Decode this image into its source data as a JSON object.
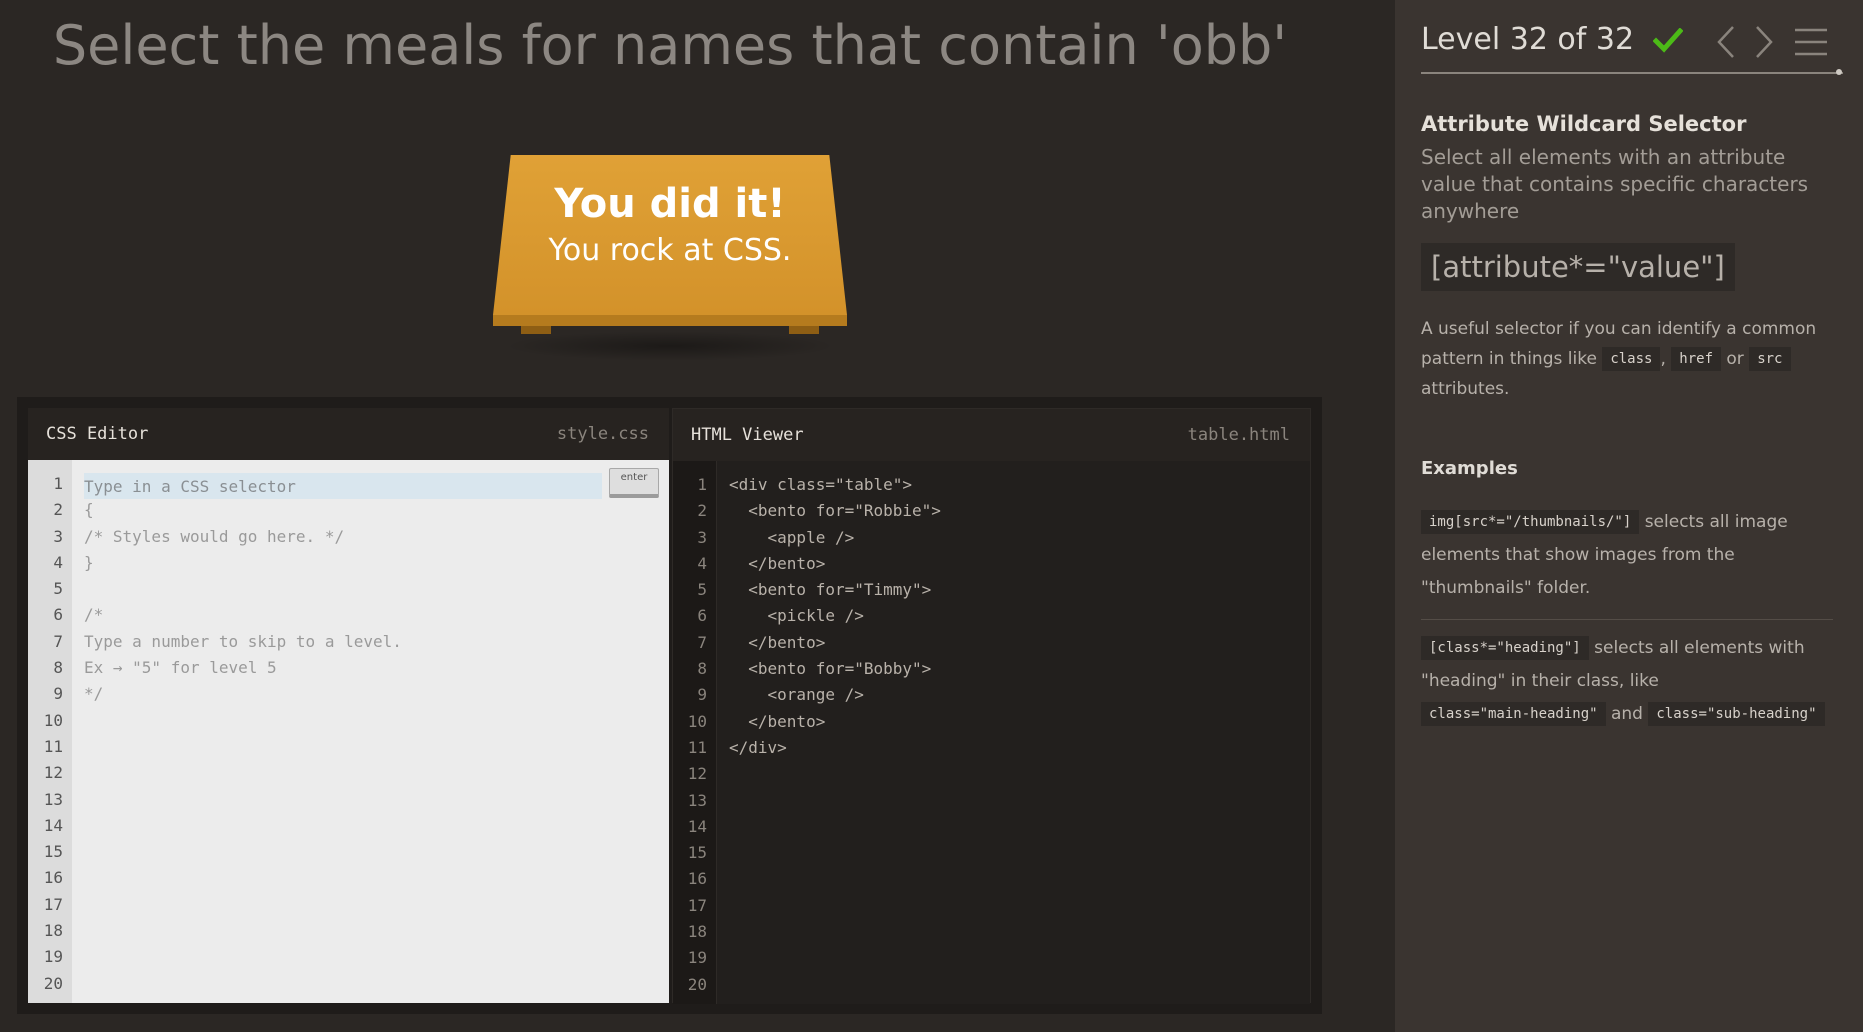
{
  "game": {
    "order": "Select the meals for names that contain 'obb'",
    "win_line1": "You did it!",
    "win_line2": "You rock at CSS."
  },
  "css_editor": {
    "title": "CSS Editor",
    "file": "style.css",
    "input_placeholder": "Type in a CSS selector",
    "enter_label": "enter",
    "line_numbers": [
      "1",
      "2",
      "3",
      "4",
      "5",
      "6",
      "7",
      "8",
      "9",
      "10",
      "11",
      "12",
      "13",
      "14",
      "15",
      "16",
      "17",
      "18",
      "19",
      "20"
    ],
    "lines": [
      "",
      "{",
      "/* Styles would go here. */",
      "}",
      "",
      "/*",
      "Type a number to skip to a level.",
      "Ex → \"5\" for level 5",
      "*/"
    ]
  },
  "html_viewer": {
    "title": "HTML Viewer",
    "file": "table.html",
    "line_numbers": [
      "1",
      "2",
      "3",
      "4",
      "5",
      "6",
      "7",
      "8",
      "9",
      "10",
      "11",
      "12",
      "13",
      "14",
      "15",
      "16",
      "17",
      "18",
      "19",
      "20"
    ],
    "lines": [
      "<div class=\"table\">",
      "  <bento for=\"Robbie\">",
      "    <apple />",
      "  </bento>",
      "  <bento for=\"Timmy\">",
      "    <pickle />",
      "  </bento>",
      "  <bento for=\"Bobby\">",
      "    <orange />",
      "  </bento>",
      "</div>"
    ]
  },
  "sidebar": {
    "level_text": "Level 32 of 32",
    "level_completed": true,
    "check_color": "#4cbb17",
    "selector_name": "Attribute Wildcard Selector",
    "title": "Select all elements with an attribute value that contains specific characters anywhere",
    "syntax": "[attribute*=\"value\"]",
    "hint_pre": "A useful selector if you can identify a common pattern in things like",
    "hint_chip1": "class",
    "hint_sep": ",",
    "hint_chip2": "href",
    "hint_or": "or",
    "hint_chip3": "src",
    "hint_post": "attributes.",
    "examples_heading": "Examples",
    "example1": {
      "code": "img[src*=\"/thumbnails/\"]",
      "text": "selects all image elements that show images from the \"thumbnails\" folder."
    },
    "example2": {
      "code": "[class*=\"heading\"]",
      "text": "selects all elements with \"heading\" in their class, like",
      "chip1": "class=\"main-heading\"",
      "and": "and",
      "chip2": "class=\"sub-heading\""
    }
  }
}
